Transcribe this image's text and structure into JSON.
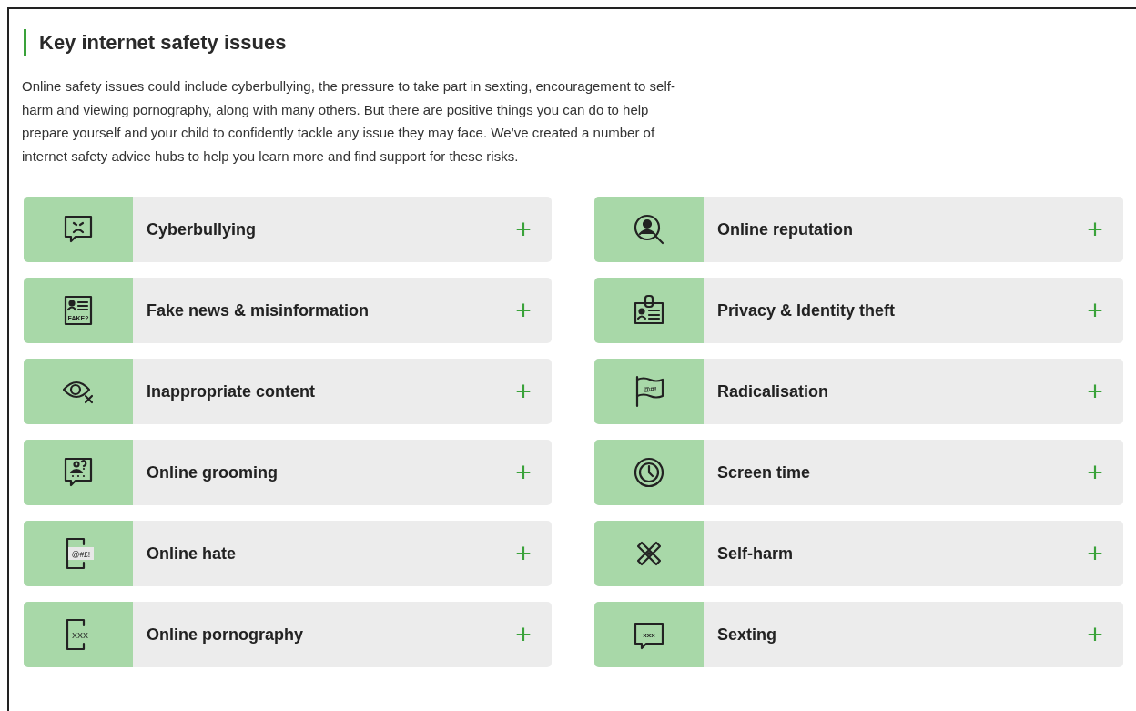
{
  "title": "Key internet safety issues",
  "intro": "Online safety issues could include cyberbullying, the pressure to take part in sexting, encouragement to self-harm and viewing pornography, along with many others. But there are positive things you can do to help prepare yourself and your child to confidently tackle any issue they may face. We’ve created a number of internet safety advice hubs to help you learn more and find support for these risks.",
  "issues": [
    {
      "label": "Cyberbullying",
      "expanded": false,
      "toggle": "+"
    },
    {
      "label": "Online reputation",
      "expanded": false,
      "toggle": "+"
    },
    {
      "label": "Fake news & misinformation",
      "expanded": false,
      "toggle": "+",
      "icon_text": "FAKE?"
    },
    {
      "label": "Privacy & Identity theft",
      "expanded": false,
      "toggle": "+"
    },
    {
      "label": "Inappropriate content",
      "expanded": false,
      "toggle": "+"
    },
    {
      "label": "Radicalisation",
      "expanded": false,
      "toggle": "+",
      "icon_text": "@#!"
    },
    {
      "label": "Online grooming",
      "expanded": false,
      "toggle": "+"
    },
    {
      "label": "Screen time",
      "expanded": false,
      "toggle": "+"
    },
    {
      "label": "Online hate",
      "expanded": false,
      "toggle": "+",
      "icon_text": "@#£!"
    },
    {
      "label": "Self-harm",
      "expanded": false,
      "toggle": "+"
    },
    {
      "label": "Online pornography",
      "expanded": false,
      "toggle": "+",
      "icon_text": "XXX"
    },
    {
      "label": "Sexting",
      "expanded": false,
      "toggle": "+",
      "icon_text": "xxx"
    }
  ]
}
